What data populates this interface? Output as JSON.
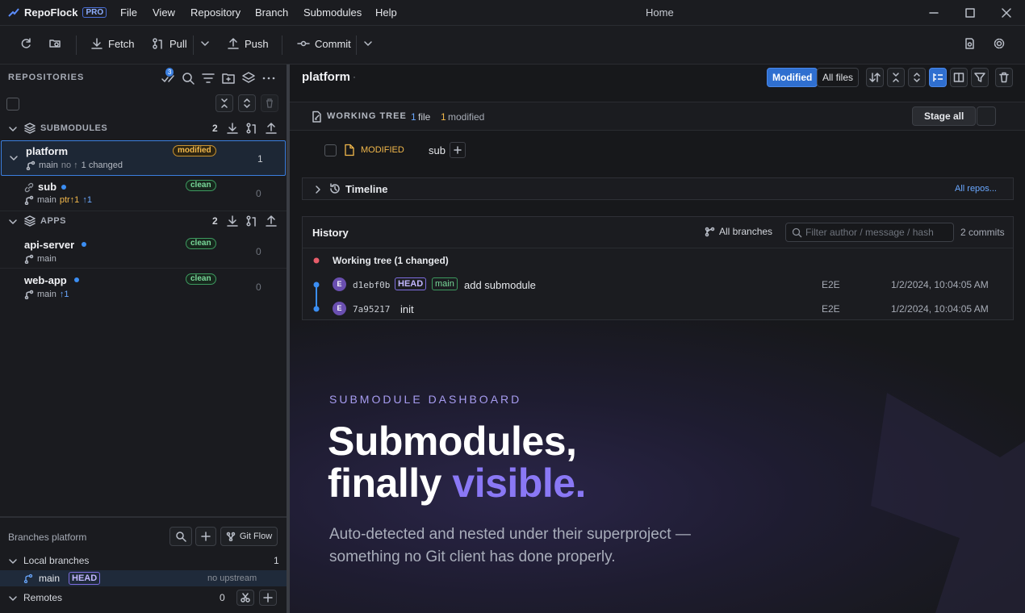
{
  "app": {
    "name": "RepoFlock",
    "tier": "PRO",
    "window_title": "Home"
  },
  "menu": [
    "File",
    "View",
    "Repository",
    "Branch",
    "Submodules",
    "Help"
  ],
  "toolbar": {
    "fetch": "Fetch",
    "pull": "Pull",
    "push": "Push",
    "commit": "Commit"
  },
  "sidebar": {
    "header": "REPOSITORIES",
    "notif_count": "3",
    "groups": [
      {
        "label": "SUBMODULES",
        "count": "2"
      },
      {
        "label": "APPS",
        "count": "2"
      }
    ],
    "repos": [
      {
        "name": "platform",
        "branch": "main",
        "upstream": "no ↑",
        "changes": "1 changed",
        "status": "modified",
        "count": "1"
      },
      {
        "name": "sub",
        "branch": "main",
        "ptr": "ptr↑1",
        "ahead": "↑1",
        "status": "clean",
        "count": "0"
      },
      {
        "name": "api-server",
        "branch": "main",
        "status": "clean",
        "count": "0"
      },
      {
        "name": "web-app",
        "branch": "main",
        "ahead": "↑1",
        "status": "clean",
        "count": "0"
      }
    ],
    "branches": {
      "title": "Branches platform",
      "gitflow": "Git Flow",
      "local_label": "Local branches",
      "local_count": "1",
      "branch_name": "main",
      "head": "HEAD",
      "no_upstream": "no upstream",
      "remotes_label": "Remotes",
      "remotes_count": "0"
    }
  },
  "main": {
    "repo_title": "platform",
    "title_dot": "·",
    "filter_modified": "Modified",
    "filter_all": "All files",
    "working_tree": {
      "label": "WORKING TREE",
      "files_num": "1",
      "files_label": "file",
      "mod_num": "1",
      "mod_label": "modified",
      "stage_all": "Stage all",
      "file_status": "MODIFIED",
      "file_name": "sub"
    },
    "timeline": {
      "label": "Timeline",
      "all_repos": "All repos..."
    },
    "history": {
      "title": "History",
      "all_branches": "All branches",
      "filter_placeholder": "Filter author / message / hash",
      "commit_count": "2 commits",
      "working_tree": "Working tree (1 changed)",
      "commits": [
        {
          "avatar": "E",
          "hash": "d1ebf0b",
          "head": "HEAD",
          "branch": "main",
          "message": "add submodule",
          "author": "E2E",
          "date": "1/2/2024, 10:04:05 AM"
        },
        {
          "avatar": "E",
          "hash": "7a95217",
          "message": "init",
          "author": "E2E",
          "date": "1/2/2024, 10:04:05 AM"
        }
      ]
    },
    "hero": {
      "eyebrow": "SUBMODULE DASHBOARD",
      "line1": "Submodules,",
      "line2a": "finally",
      "line2b": "visible.",
      "sub1": "Auto-detected and nested under their superproject —",
      "sub2": "something no Git client has done properly."
    }
  },
  "colors": {
    "accent": "#3b7fe0",
    "modified": "#f2b84b",
    "clean": "#79d99a",
    "hero_accent": "#8a78f5"
  }
}
